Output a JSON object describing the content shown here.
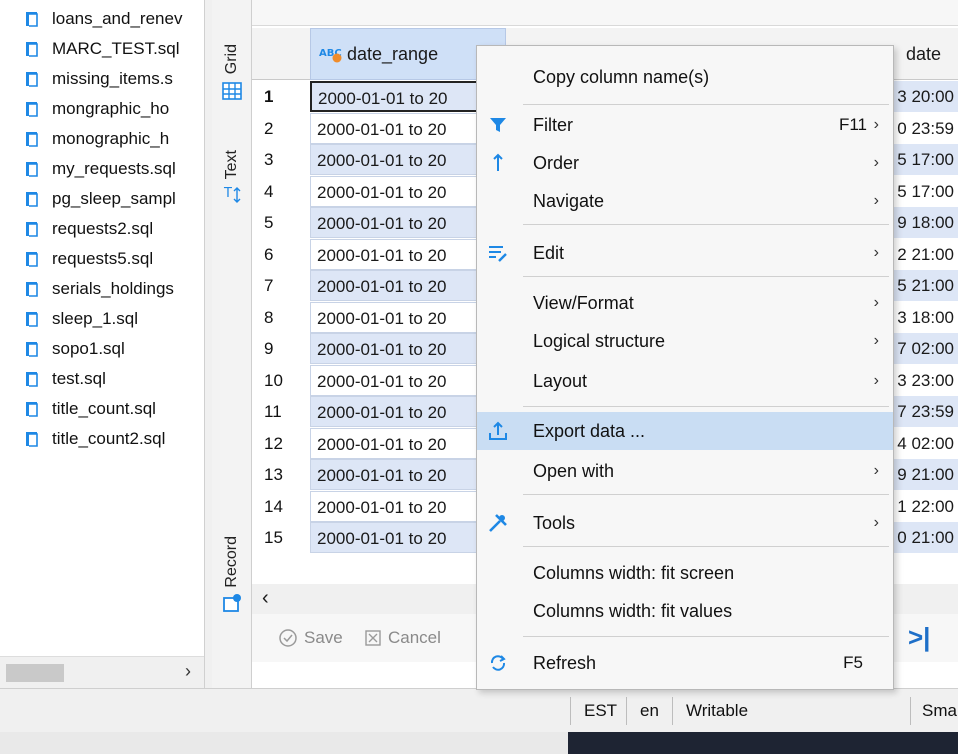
{
  "files": [
    "loans_and_renev",
    "MARC_TEST.sql",
    "missing_items.s",
    "mongraphic_ho",
    "monographic_h",
    "my_requests.sql",
    "pg_sleep_sampl",
    "requests2.sql",
    "requests5.sql",
    "serials_holdings",
    "sleep_1.sql",
    "sopo1.sql",
    "test.sql",
    "title_count.sql",
    "title_count2.sql"
  ],
  "side_tabs": {
    "grid": "Grid",
    "text": "Text",
    "record": "Record"
  },
  "grid": {
    "col_date_range": "date_range",
    "col_date": "date",
    "rows": [
      {
        "n": "1",
        "v": "2000-01-01 to 20",
        "d": "3 20:00"
      },
      {
        "n": "2",
        "v": "2000-01-01 to 20",
        "d": "0 23:59"
      },
      {
        "n": "3",
        "v": "2000-01-01 to 20",
        "d": "5 17:00"
      },
      {
        "n": "4",
        "v": "2000-01-01 to 20",
        "d": "5 17:00"
      },
      {
        "n": "5",
        "v": "2000-01-01 to 20",
        "d": "9 18:00"
      },
      {
        "n": "6",
        "v": "2000-01-01 to 20",
        "d": "2 21:00"
      },
      {
        "n": "7",
        "v": "2000-01-01 to 20",
        "d": "5 21:00"
      },
      {
        "n": "8",
        "v": "2000-01-01 to 20",
        "d": "3 18:00"
      },
      {
        "n": "9",
        "v": "2000-01-01 to 20",
        "d": "7 02:00"
      },
      {
        "n": "10",
        "v": "2000-01-01 to 20",
        "d": "3 23:00"
      },
      {
        "n": "11",
        "v": "2000-01-01 to 20",
        "d": "7 23:59"
      },
      {
        "n": "12",
        "v": "2000-01-01 to 20",
        "d": "4 02:00"
      },
      {
        "n": "13",
        "v": "2000-01-01 to 20",
        "d": "9 21:00"
      },
      {
        "n": "14",
        "v": "2000-01-01 to 20",
        "d": "1 22:00"
      },
      {
        "n": "15",
        "v": "2000-01-01 to 20",
        "d": "0 21:00"
      }
    ]
  },
  "toolbar": {
    "save": "Save",
    "cancel": "Cancel"
  },
  "status": {
    "tz": "EST",
    "lang": "en",
    "mode": "Writable",
    "smart": "Sma"
  },
  "menu": {
    "copy_column_names": "Copy column name(s)",
    "filter": "Filter",
    "filter_shortcut": "F11",
    "order": "Order",
    "navigate": "Navigate",
    "edit": "Edit",
    "view_format": "View/Format",
    "logical_structure": "Logical structure",
    "layout": "Layout",
    "export_data": "Export data ...",
    "open_with": "Open with",
    "tools": "Tools",
    "col_fit_screen": "Columns width: fit screen",
    "col_fit_values": "Columns width: fit values",
    "refresh": "Refresh",
    "refresh_shortcut": "F5"
  },
  "colors": {
    "accent": "#1e88e5",
    "row_alt": "#dde6f6",
    "highlight": "#c9ddf3"
  }
}
